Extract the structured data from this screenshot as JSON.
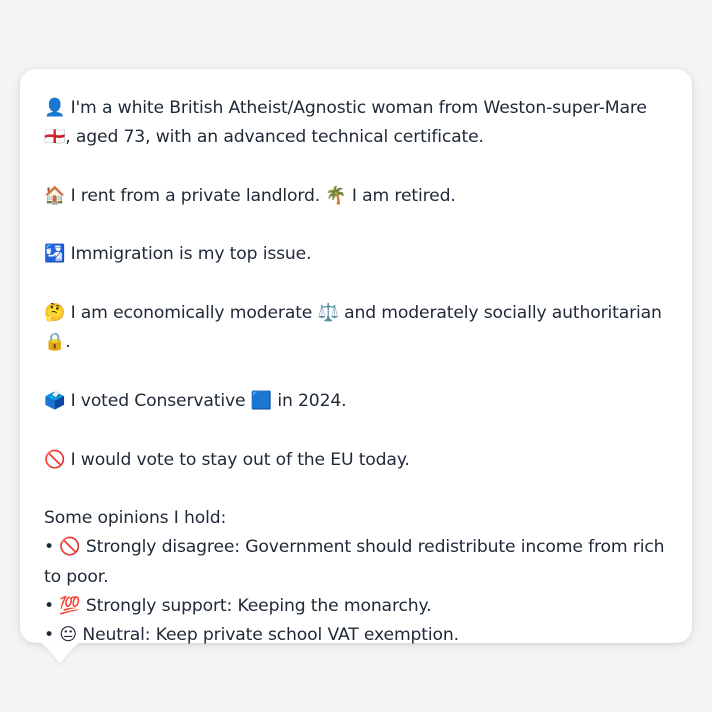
{
  "profile": {
    "line1": "👤 I'm a white British Atheist/Agnostic woman from Weston-super-Mare 🏴󠁧󠁢󠁥󠁮󠁧󠁿, aged 73, with an advanced technical certificate.",
    "line2": "🏠 I rent from a private landlord. 🌴 I am retired.",
    "line3": "🛂 Immigration is my top issue.",
    "line4": "🤔 I am economically moderate ⚖️ and moderately socially authoritarian 🔒.",
    "line5": "🗳️ I voted Conservative 🟦 in 2024.",
    "line6": "🚫 I would vote to stay out of the EU today."
  },
  "opinions": {
    "heading": "Some opinions I hold:",
    "items": [
      "• 🚫 Strongly disagree: Government should redistribute income from rich to poor.",
      "• 💯 Strongly support: Keeping the monarchy.",
      "• 😐 Neutral: Keep private school VAT exemption."
    ]
  },
  "colors": {
    "background": "#f3f4f6",
    "bubble": "#ffffff",
    "text": "#1f2937"
  }
}
